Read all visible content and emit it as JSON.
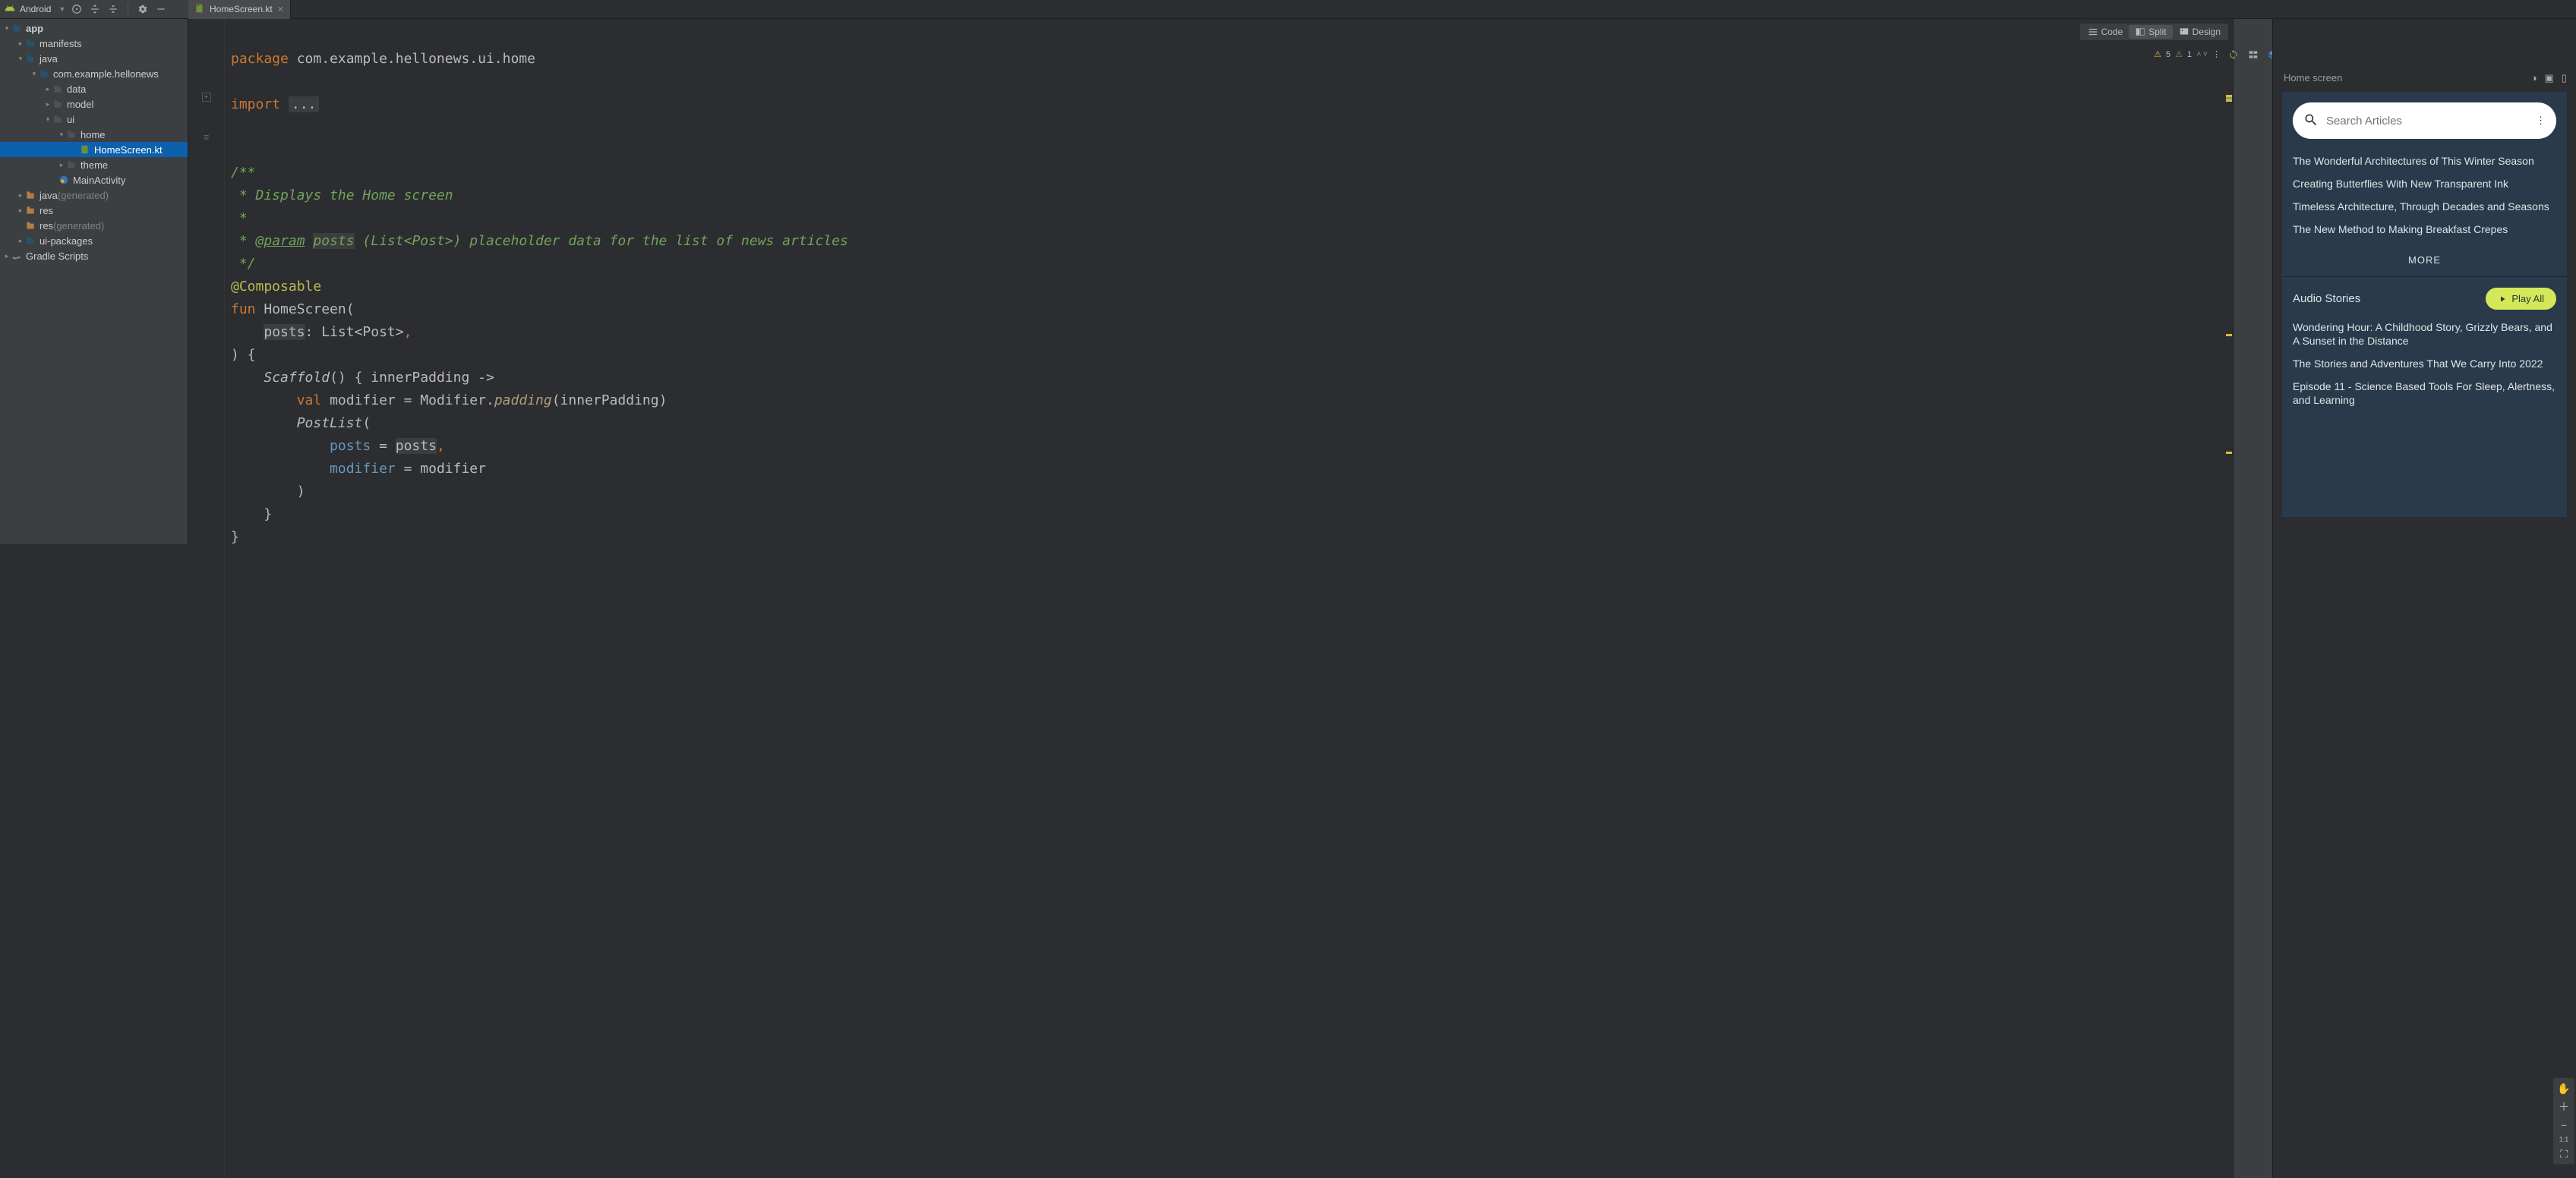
{
  "toolbar": {
    "project_label": "Android"
  },
  "tab": {
    "filename": "HomeScreen.kt"
  },
  "tree": {
    "root": "app",
    "items": [
      "manifests",
      "java",
      "com.example.hellonews",
      "data",
      "model",
      "ui",
      "home",
      "HomeScreen.kt",
      "theme",
      "MainActivity",
      "java",
      "res",
      "res",
      "ui-packages",
      "Gradle Scripts"
    ],
    "generated_suffix": "(generated)"
  },
  "viewmodes": {
    "code": "Code",
    "split": "Split",
    "design": "Design"
  },
  "annotations": {
    "warn_count": "5",
    "typo_count": "1"
  },
  "code": {
    "package_kw": "package",
    "package_path": "com.example.hellonews.ui.home",
    "import_kw": "import",
    "import_rest": "...",
    "c1": "/**",
    "c2": " * Displays the Home screen",
    "c3": " *",
    "c4a": " * ",
    "c4_tag": "@param",
    "c4_name": "posts",
    "c4_rest": "(List<Post>) placeholder data for the list of news articles",
    "c5": " */",
    "anno": "@Composable",
    "fun_kw": "fun",
    "fun_name": "HomeScreen",
    "param_name": "posts",
    "param_type": "List<Post>",
    "scaffold": "Scaffold",
    "inner": "innerPadding ->",
    "val_kw": "val",
    "modifier_var": "modifier",
    "modifier_expr_a": "Modifier.",
    "modifier_expr_b": "padding",
    "modifier_expr_c": "(innerPadding)",
    "postlist": "PostList",
    "arg1_k": "posts",
    "arg1_v": "posts",
    "arg2_k": "modifier",
    "arg2_v": "modifier"
  },
  "preview": {
    "header_label": "Home screen",
    "search_placeholder": "Search Articles",
    "articles": [
      "The Wonderful Architectures of This Winter Season",
      "Creating Butterflies With New Transparent Ink",
      "Timeless Architecture, Through Decades and Seasons",
      "The New Method to Making Breakfast Crepes"
    ],
    "more_label": "MORE",
    "audio_section": "Audio Stories",
    "play_all": "Play All",
    "audio_items": [
      "Wondering Hour: A Childhood Story, Grizzly Bears, and A Sunset in the Distance",
      "The Stories and Adventures That We Carry Into 2022",
      "Episode 11 - Science Based Tools For Sleep, Alertness, and Learning"
    ]
  },
  "zoom": {
    "one_to_one": "1:1"
  }
}
